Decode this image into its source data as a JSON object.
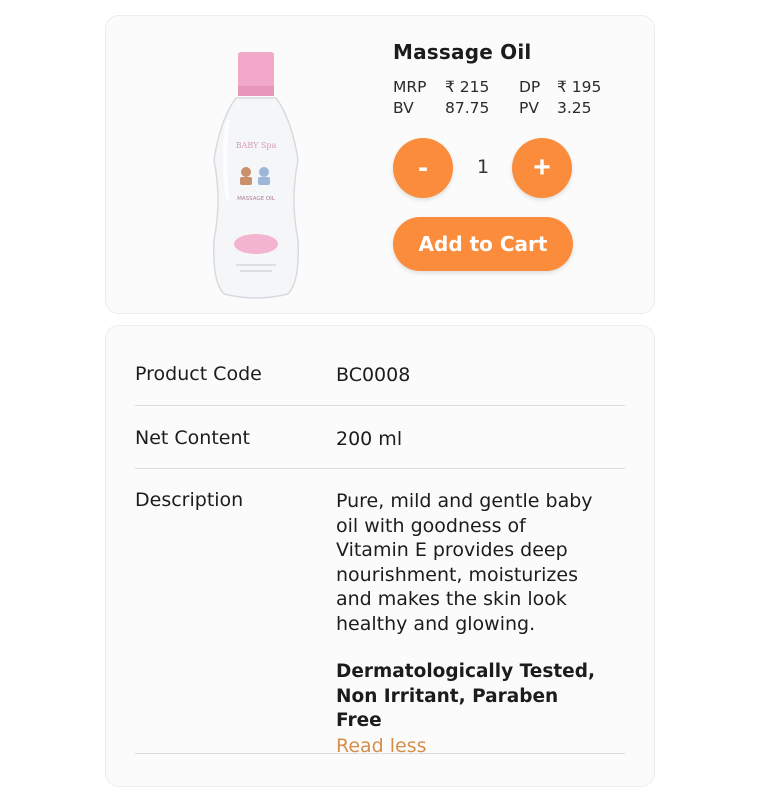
{
  "product": {
    "name": "Massage Oil",
    "bottle_label_brand": "BABY Spa",
    "bottle_label_type": "MASSAGE OIL",
    "prices": {
      "mrp_label": "MRP",
      "mrp_value": "₹ 215",
      "dp_label": "DP",
      "dp_value": "₹ 195",
      "bv_label": "BV",
      "bv_value": "87.75",
      "pv_label": "PV",
      "pv_value": "3.25"
    },
    "quantity": "1",
    "minus_label": "-",
    "plus_label": "+",
    "add_to_cart_label": "Add to Cart"
  },
  "details": {
    "code_label": "Product Code",
    "code_value": "BC0008",
    "net_label": "Net Content",
    "net_value": "200 ml",
    "desc_label": "Description",
    "desc_text": "Pure, mild and gentle baby oil with goodness of Vitamin E provides deep nourishment, moisturizes and makes the skin look healthy and glowing.",
    "desc_bold": "Dermatologically Tested, Non Irritant, Paraben Free",
    "read_less_label": "Read less"
  },
  "colors": {
    "accent": "#fb8c3c",
    "link": "#d4904a",
    "cap": "#f2a8c8"
  }
}
